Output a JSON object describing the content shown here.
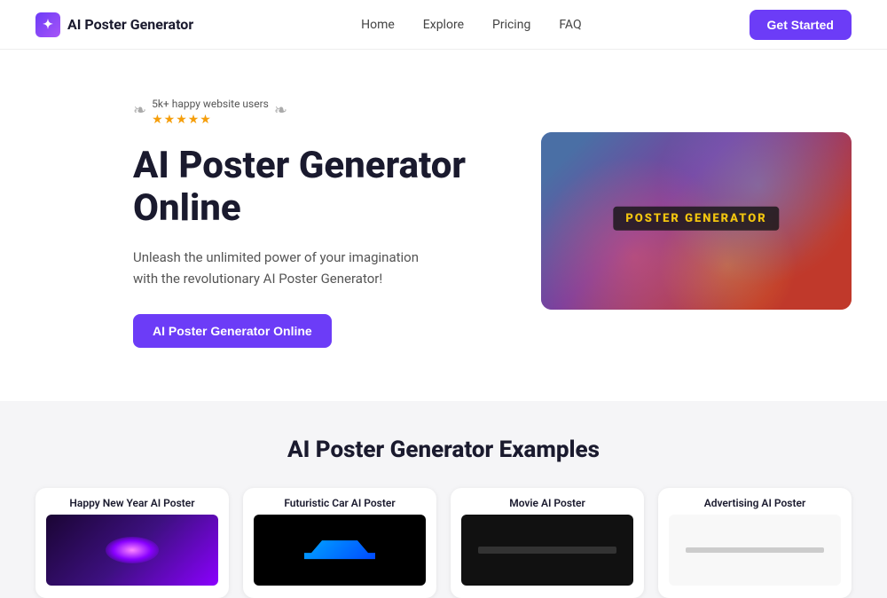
{
  "nav": {
    "logo_text": "AI Poster Generator",
    "links": [
      {
        "label": "Home",
        "id": "home"
      },
      {
        "label": "Explore",
        "id": "explore"
      },
      {
        "label": "Pricing",
        "id": "pricing"
      },
      {
        "label": "FAQ",
        "id": "faq"
      }
    ],
    "cta_label": "Get Started"
  },
  "hero": {
    "badge_text": "5k+ happy website users",
    "stars": "★★★★★",
    "title": "AI Poster Generator Online",
    "description": "Unleash the unlimited power of your imagination with the revolutionary AI Poster Generator!",
    "cta_label": "AI Poster Generator Online",
    "image_label": "POSTER GENERATOR"
  },
  "examples": {
    "section_title": "AI Poster Generator Examples",
    "cards": [
      {
        "title": "Happy New Year AI Poster",
        "type": "newyear"
      },
      {
        "title": "Futuristic Car AI Poster",
        "type": "car"
      },
      {
        "title": "Movie AI Poster",
        "type": "movie"
      },
      {
        "title": "Advertising AI Poster",
        "type": "ad"
      }
    ]
  }
}
